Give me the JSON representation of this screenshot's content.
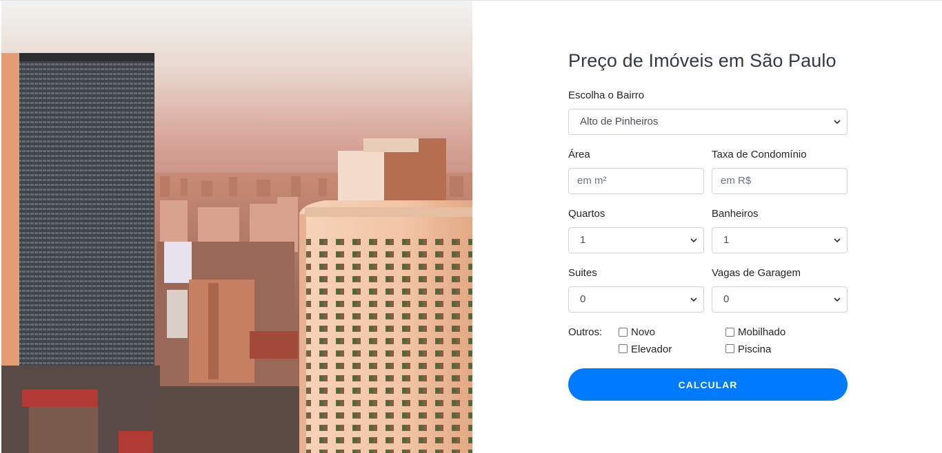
{
  "form": {
    "title": "Preço de Imóveis em São Paulo",
    "bairro_label": "Escolha o Bairro",
    "bairro_value": "Alto de Pinheiros",
    "area_label": "Área",
    "area_placeholder": "em m²",
    "condominio_label": "Taxa de Condomínio",
    "condominio_placeholder": "em R$",
    "quartos_label": "Quartos",
    "quartos_value": "1",
    "banheiros_label": "Banheiros",
    "banheiros_value": "1",
    "suites_label": "Suites",
    "suites_value": "0",
    "vagas_label": "Vagas de Garagem",
    "vagas_value": "0",
    "outros_label": "Outros:",
    "outros_options": [
      "Novo",
      "Mobilhado",
      "Elevador",
      "Piscina"
    ],
    "submit_label": "CALCULAR"
  },
  "colors": {
    "accent": "#007bff",
    "border": "#ced4da"
  },
  "icons": {
    "select_arrow": "chevron-down-icon",
    "checkbox": "checkbox-icon"
  }
}
